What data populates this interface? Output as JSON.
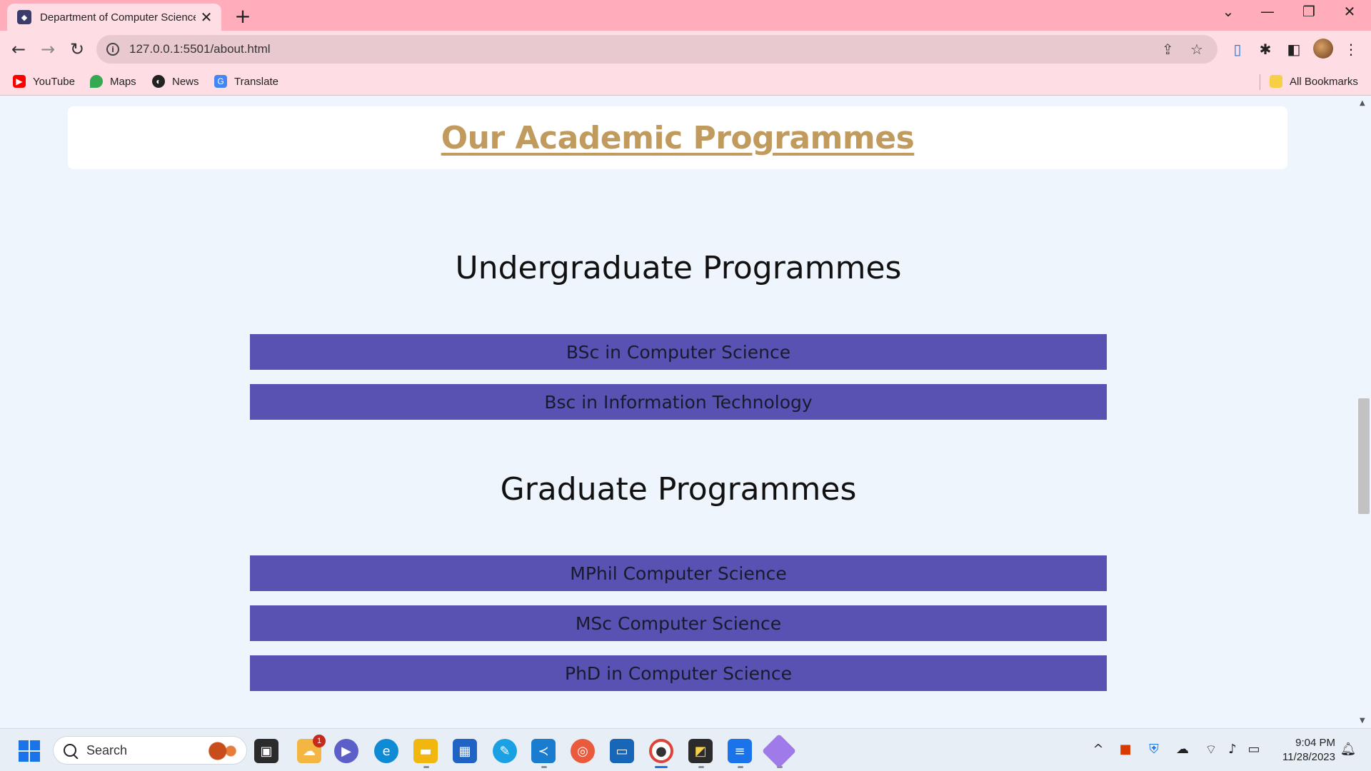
{
  "browser": {
    "tab_title": "Department of Computer Science",
    "tab_close": "✕",
    "new_tab": "+",
    "url": "127.0.0.1:5501/about.html",
    "bookmarks": [
      {
        "label": "YouTube",
        "icon": "youtube-icon",
        "color": "#ff0000"
      },
      {
        "label": "Maps",
        "icon": "maps-icon",
        "color": "#34a853"
      },
      {
        "label": "News",
        "icon": "news-icon",
        "color": "#222222"
      },
      {
        "label": "Translate",
        "icon": "translate-icon",
        "color": "#4285f4"
      }
    ],
    "all_bookmarks": "All Bookmarks"
  },
  "page": {
    "heading": "Our Academic Programmes",
    "undergrad": {
      "title": "Undergraduate Programmes",
      "items": [
        "BSc in Computer Science",
        "Bsc in Information Technology"
      ]
    },
    "graduate": {
      "title": "Graduate Programmes",
      "items": [
        "MPhil Computer Science",
        "MSc Computer Science",
        "PhD in Computer Science"
      ]
    }
  },
  "taskbar": {
    "search_placeholder": "Search",
    "notification_count": "1",
    "time": "9:04 PM",
    "date": "11/28/2023"
  },
  "colors": {
    "heading": "#c19a5e",
    "button_bg": "#5852b2",
    "page_bg": "#eef5fd",
    "tabbar_bg": "#ffacbb",
    "toolbar_bg": "#ffdde4"
  }
}
